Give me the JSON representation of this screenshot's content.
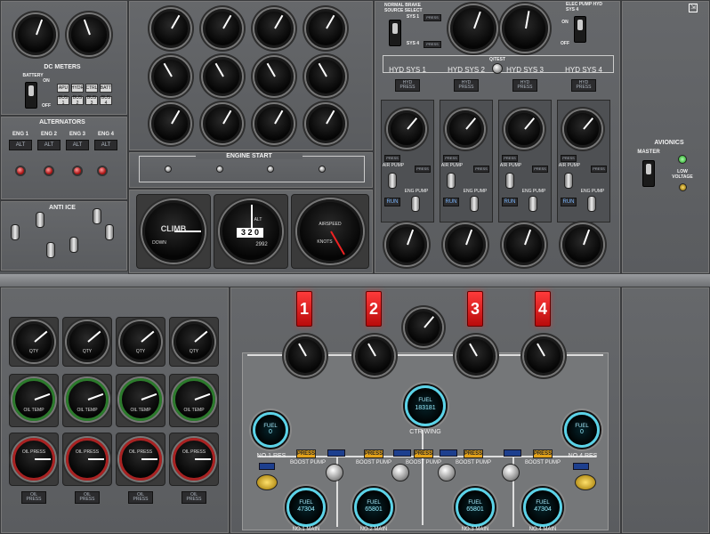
{
  "dc_meters": {
    "title": "DC METERS",
    "battery_label": "BATTERY",
    "on": "ON",
    "off": "OFF",
    "buttons": [
      "APU",
      "HYDR",
      "CTRL",
      "BATT",
      "BUS 1",
      "BUS 2",
      "BUS 3",
      "BUS 4"
    ]
  },
  "alternators": {
    "title": "ALTERNATORS",
    "engines": [
      "ENG 1",
      "ENG 2",
      "ENG 3",
      "ENG 4"
    ],
    "alt_label": "ALT"
  },
  "anti_ice": {
    "title": "ANTI ICE"
  },
  "engine_start": {
    "title": "ENGINE START"
  },
  "flight_instruments": {
    "climb_label": "CLIMB",
    "down_label": "DOWN",
    "alt_label": "ALT",
    "alt_value": "3 2 0",
    "alt_small": "2992",
    "airspeed_label": "AIRSPEED",
    "knots": "KNOTS"
  },
  "hyd": {
    "brake_title": "NORMAL BRAKE SOURCE SELECT",
    "sys1": "SYS 1",
    "sys4": "SYS 4",
    "elec_pump_title": "ELEC PUMP HYD SYS 4",
    "on": "ON",
    "off": "OFF",
    "q_test": "Q/TEST",
    "systems": [
      "HYD SYS 1",
      "HYD SYS 2",
      "HYD SYS 3",
      "HYD SYS 4"
    ],
    "hyd_press": "HYD PRESS",
    "press": "PRESS",
    "air_pump": "AIR PUMP",
    "eng_pump": "ENG PUMP",
    "run": "RUN"
  },
  "avionics": {
    "title": "AVIONICS",
    "master": "MASTER",
    "low_voltage": "LOW VOLTAGE"
  },
  "engine_gauges": {
    "oil_temp": "OIL TEMP",
    "oil_press": "OIL PRESS",
    "qty": "QTY",
    "oil_press_btn": "OIL PRESS"
  },
  "fuel": {
    "fire_handles": [
      "1",
      "2",
      "3",
      "4"
    ],
    "press": "PRESS",
    "boost_pump": "BOOST PUMP",
    "ctr_wing": "CTR WING",
    "ctr_value": "183181",
    "no1_res": "NO.1 RES",
    "no4_res": "NO.4 RES",
    "no1_main": "NO.1 MAIN",
    "no2_main": "NO.2 MAIN",
    "no3_main": "NO.3 MAIN",
    "no4_main": "NO.4 MAIN",
    "res_value": "0",
    "main1": "47304",
    "main2": "65801",
    "main3": "65801",
    "main4": "47304",
    "fuel": "FUEL",
    "lbs": "lbs"
  }
}
